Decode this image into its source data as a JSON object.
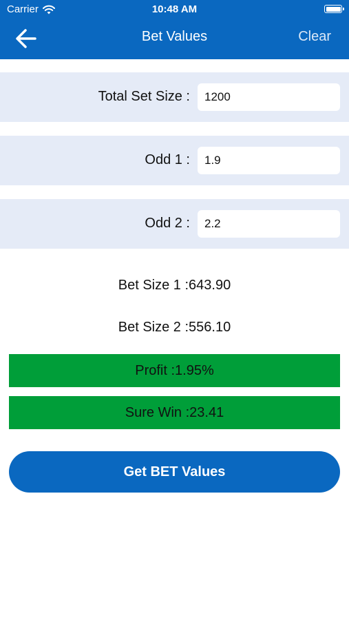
{
  "status_bar": {
    "carrier": "Carrier",
    "time": "10:48 AM"
  },
  "nav": {
    "title": "Bet Values",
    "clear_label": "Clear",
    "back_icon": "arrow-left-icon"
  },
  "form": {
    "total_set_size": {
      "label": "Total Set Size :",
      "value": "1200"
    },
    "odd1": {
      "label": "Odd 1 :",
      "value": "1.9"
    },
    "odd2": {
      "label": "Odd 2 :",
      "value": "2.2"
    }
  },
  "results": {
    "bet_size_1": "Bet Size 1 :643.90",
    "bet_size_2": "Bet Size 2 :556.10",
    "profit": "Profit :1.95%",
    "sure_win": "Sure Win :23.41"
  },
  "actions": {
    "get_bet_values_label": "Get BET Values"
  },
  "colors": {
    "primary": "#0a68c0",
    "row_background": "#e5ebf7",
    "success": "#009e39"
  }
}
